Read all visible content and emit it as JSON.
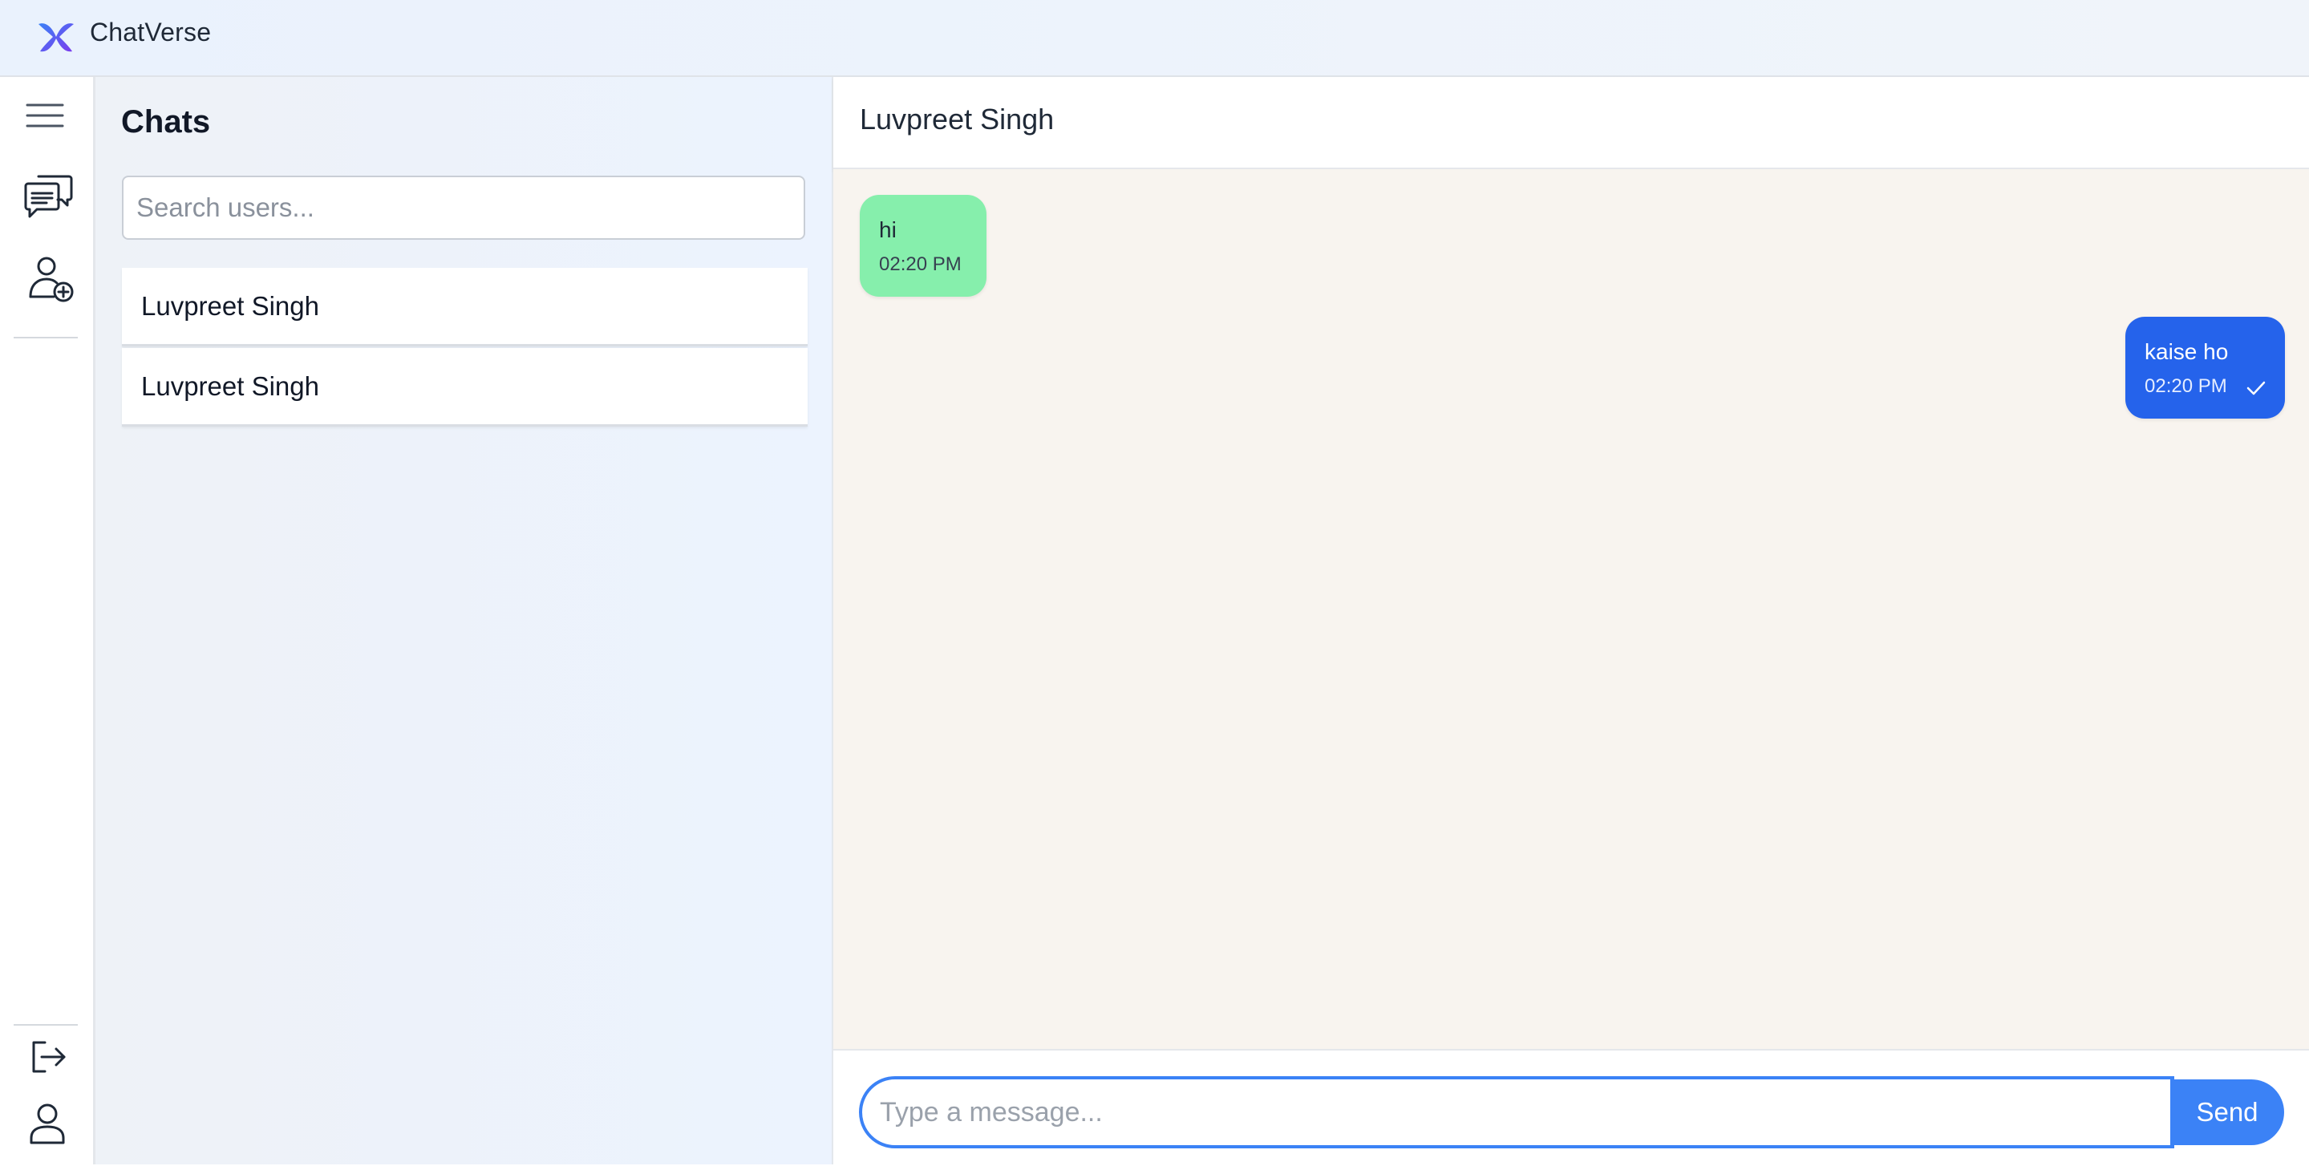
{
  "app": {
    "title": "ChatVerse",
    "logo_icon": "chatverse-logo-icon"
  },
  "rail": {
    "top_icons": [
      "menu-icon",
      "chats-icon",
      "add-user-icon"
    ],
    "bottom_icons": [
      "logout-icon",
      "profile-icon"
    ]
  },
  "chat_list": {
    "heading": "Chats",
    "search_placeholder": "Search users...",
    "search_value": "",
    "items": [
      {
        "name": "Luvpreet Singh"
      },
      {
        "name": "Luvpreet Singh"
      }
    ]
  },
  "conversation": {
    "title": "Luvpreet Singh",
    "messages": [
      {
        "direction": "incoming",
        "text": "hi",
        "time": "02:20 PM",
        "status_icon": ""
      },
      {
        "direction": "outgoing",
        "text": "kaise ho",
        "time": "02:20 PM",
        "status_icon": "check-icon"
      }
    ]
  },
  "composer": {
    "placeholder": "Type a message...",
    "value": "",
    "send_label": "Send"
  },
  "colors": {
    "accent": "#3b82f6",
    "outgoing_bubble": "#2563eb",
    "incoming_bubble": "#86efac",
    "chat_background": "#f8f4ef"
  }
}
